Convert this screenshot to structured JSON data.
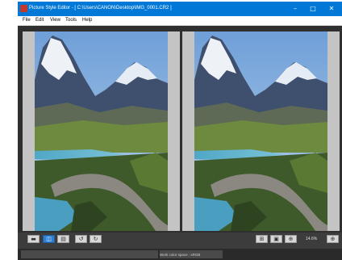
{
  "window": {
    "title": "Picture Style Editor - [ C:\\Users\\CANON\\Desktop\\IMG_0001.CR2 ]",
    "controls": {
      "minimize": "–",
      "maximize": "□",
      "close": "✕"
    }
  },
  "menu": {
    "items": [
      "File",
      "Edit",
      "View",
      "Tools",
      "Help"
    ]
  },
  "toolbar": {
    "left_icons": [
      "single-view-icon",
      "side-by-side-view-icon",
      "split-view-icon",
      "rotate-left-icon",
      "rotate-right-icon"
    ],
    "right_icons": [
      "fit-to-window-icon",
      "actual-size-icon",
      "zoom-icon",
      "zoom-menu-icon"
    ],
    "zoom_level": "14.6%"
  },
  "status": {
    "color_space": "Work color space : sRGB"
  },
  "images": {
    "left": {
      "label": "original-image"
    },
    "right": {
      "label": "adjusted-image"
    }
  }
}
